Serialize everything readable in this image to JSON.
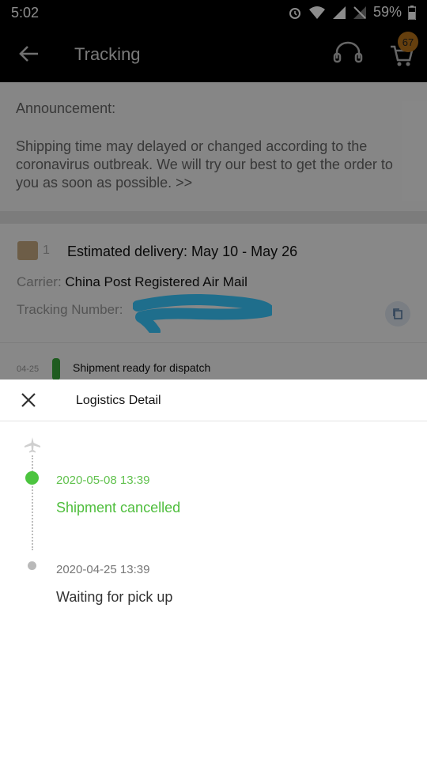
{
  "status_bar": {
    "time": "5:02",
    "battery": "59%"
  },
  "app_bar": {
    "title": "Tracking",
    "cart_count": "67"
  },
  "announcement": {
    "heading": "Announcement:",
    "body": "Shipping time may delayed or changed according to the coronavirus outbreak. We will try our best to get the order to you as soon as possible. >>"
  },
  "shipment": {
    "package_number": "1",
    "estimated_delivery": "Estimated delivery: May 10 - May 26",
    "carrier_label": "Carrier:",
    "carrier_value": "China Post Registered Air Mail",
    "tracking_label": "Tracking Number:",
    "event_date": "04-25",
    "event_text": "Shipment ready for dispatch"
  },
  "sheet": {
    "title": "Logistics Detail",
    "events": [
      {
        "time": "2020-05-08 13:39",
        "text": "Shipment cancelled"
      },
      {
        "time": "2020-04-25 13:39",
        "text": "Waiting for pick up"
      }
    ]
  },
  "colors": {
    "accent_green": "#4cc43f",
    "badge": "#b8741b",
    "redaction": "#39c8ff"
  }
}
